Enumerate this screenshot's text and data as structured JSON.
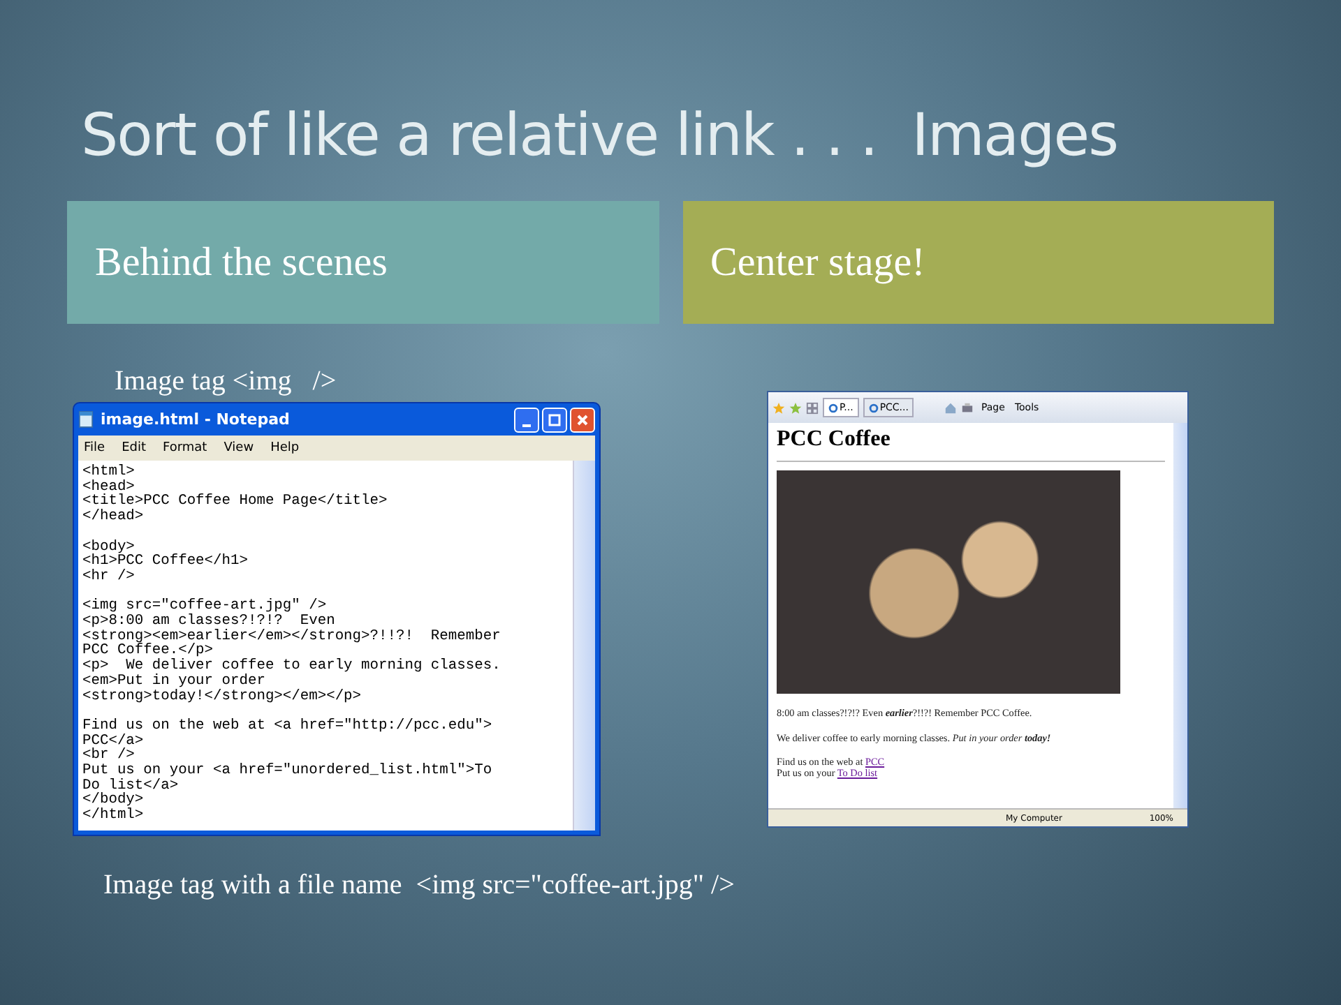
{
  "title": "Sort of like a relative link . . .  Images",
  "headers": [
    {
      "label": "Behind the scenes",
      "color": "#73aaa9"
    },
    {
      "label": "Center stage!",
      "color": "#a4ad55"
    }
  ],
  "caption_top": "Image tag <img   />",
  "notepad": {
    "title": "image.html - Notepad",
    "menu": [
      "File",
      "Edit",
      "Format",
      "View",
      "Help"
    ],
    "blocks": [
      [
        "<html>",
        "<head>",
        "<title>PCC Coffee Home Page</title>",
        "</head>"
      ],
      [
        "<body>",
        "<h1>PCC Coffee</h1>",
        "<hr />"
      ],
      [
        "<img src=\"coffee-art.jpg\" />",
        "<p>8:00 am classes?!?!?  Even",
        "<strong><em>earlier</em></strong>?!!?!  Remember",
        "PCC Coffee.</p>",
        "<p>  We deliver coffee to early morning classes.",
        "<em>Put in your order",
        "<strong>today!</strong></em></p>"
      ],
      [
        "Find us on the web at <a href=\"http://pcc.edu\">",
        "PCC</a>",
        "<br />",
        "Put us on your <a href=\"unordered_list.html\">To",
        "Do list</a>",
        "</body>",
        "</html>"
      ]
    ]
  },
  "browser": {
    "tabs": [
      {
        "label": "P...",
        "selected": true
      },
      {
        "label": "PCC...",
        "selected": false
      }
    ],
    "toolbar": [
      "Page",
      "Tools"
    ],
    "heading": "PCC Coffee",
    "paragraphs": [
      "8:00 am classes?!?!? Even **earlier**?!!?! Remember PCC Coffee.",
      "We deliver coffee to early morning classes. *Put in your order* **today!**"
    ],
    "links": [
      {
        "text": "Find us on the web at ",
        "link": "PCC"
      },
      {
        "text": "Put us on your ",
        "link": "To Do list"
      }
    ],
    "status": {
      "zone": "My Computer",
      "zoom": "100%"
    }
  },
  "caption_bottom": "Image tag with a file name  <img src=\"coffee-art.jpg\" />"
}
